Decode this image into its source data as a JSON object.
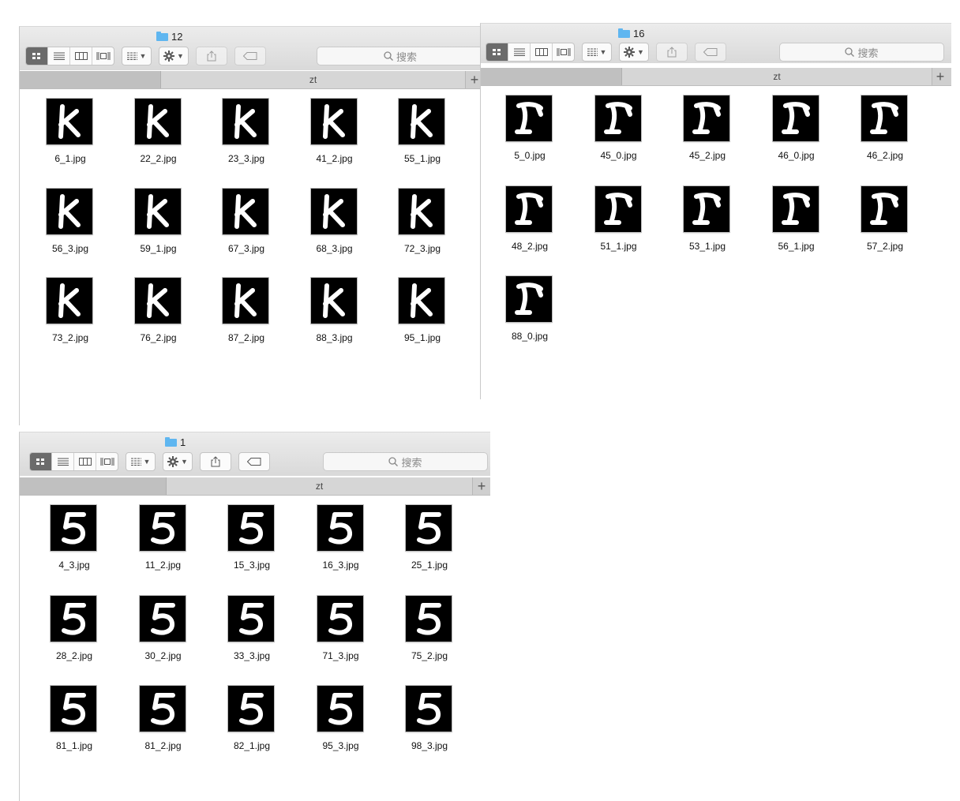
{
  "windows": [
    {
      "title": "12",
      "search_placeholder": "搜索",
      "tab": "zt",
      "files": [
        {
          "name": "6_1.jpg",
          "glyph": "k"
        },
        {
          "name": "22_2.jpg",
          "glyph": "k"
        },
        {
          "name": "23_3.jpg",
          "glyph": "k"
        },
        {
          "name": "41_2.jpg",
          "glyph": "k"
        },
        {
          "name": "55_1.jpg",
          "glyph": "k"
        },
        {
          "name": "56_3.jpg",
          "glyph": "k"
        },
        {
          "name": "59_1.jpg",
          "glyph": "k"
        },
        {
          "name": "67_3.jpg",
          "glyph": "k"
        },
        {
          "name": "68_3.jpg",
          "glyph": "k"
        },
        {
          "name": "72_3.jpg",
          "glyph": "k"
        },
        {
          "name": "73_2.jpg",
          "glyph": "k"
        },
        {
          "name": "76_2.jpg",
          "glyph": "k"
        },
        {
          "name": "87_2.jpg",
          "glyph": "k"
        },
        {
          "name": "88_3.jpg",
          "glyph": "k"
        },
        {
          "name": "95_1.jpg",
          "glyph": "k"
        }
      ]
    },
    {
      "title": "16",
      "search_placeholder": "搜索",
      "tab": "zt",
      "files": [
        {
          "name": "5_0.jpg",
          "glyph": "r"
        },
        {
          "name": "45_0.jpg",
          "glyph": "r"
        },
        {
          "name": "45_2.jpg",
          "glyph": "r"
        },
        {
          "name": "46_0.jpg",
          "glyph": "r"
        },
        {
          "name": "46_2.jpg",
          "glyph": "r"
        },
        {
          "name": "48_2.jpg",
          "glyph": "r"
        },
        {
          "name": "51_1.jpg",
          "glyph": "r"
        },
        {
          "name": "53_1.jpg",
          "glyph": "r"
        },
        {
          "name": "56_1.jpg",
          "glyph": "r"
        },
        {
          "name": "57_2.jpg",
          "glyph": "r"
        },
        {
          "name": "88_0.jpg",
          "glyph": "r"
        }
      ]
    },
    {
      "title": "1",
      "search_placeholder": "搜索",
      "tab": "zt",
      "files": [
        {
          "name": "4_3.jpg",
          "glyph": "5"
        },
        {
          "name": "11_2.jpg",
          "glyph": "5"
        },
        {
          "name": "15_3.jpg",
          "glyph": "5"
        },
        {
          "name": "16_3.jpg",
          "glyph": "5"
        },
        {
          "name": "25_1.jpg",
          "glyph": "5"
        },
        {
          "name": "28_2.jpg",
          "glyph": "5"
        },
        {
          "name": "30_2.jpg",
          "glyph": "5"
        },
        {
          "name": "33_3.jpg",
          "glyph": "5"
        },
        {
          "name": "71_3.jpg",
          "glyph": "5"
        },
        {
          "name": "75_2.jpg",
          "glyph": "5"
        },
        {
          "name": "81_1.jpg",
          "glyph": "5"
        },
        {
          "name": "81_2.jpg",
          "glyph": "5"
        },
        {
          "name": "82_1.jpg",
          "glyph": "5"
        },
        {
          "name": "95_3.jpg",
          "glyph": "5"
        },
        {
          "name": "98_3.jpg",
          "glyph": "5"
        }
      ]
    }
  ],
  "icons": {
    "view_modes": [
      "icon-view-icon",
      "list-view-icon",
      "column-view-icon",
      "gallery-view-icon"
    ],
    "group": "group-icon",
    "action": "gear-icon",
    "share": "share-icon",
    "tag": "tag-icon",
    "search": "magnifier-icon",
    "folder": "folder-icon",
    "new_tab": "plus-icon"
  },
  "colors": {
    "folder": "#5fb6f0",
    "active_view": "#6b6b6b",
    "thumb_bg": "#000000",
    "thumb_fg": "#ffffff"
  }
}
